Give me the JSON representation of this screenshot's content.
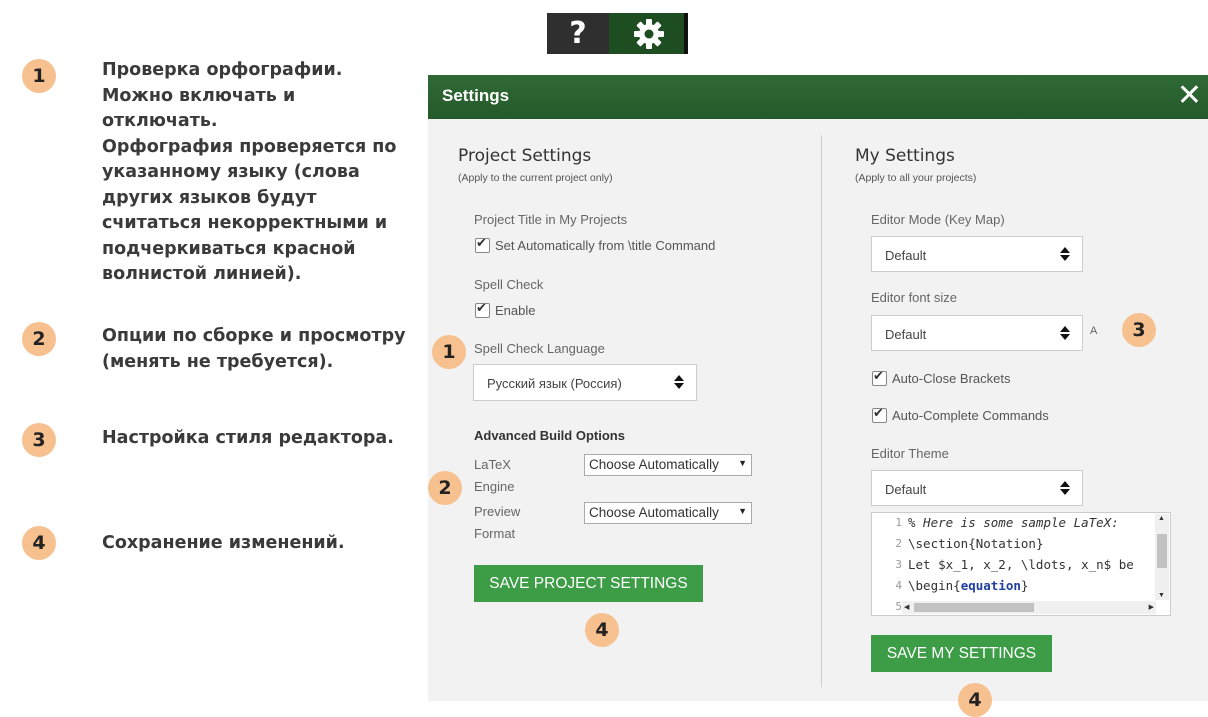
{
  "legend": [
    {
      "num": "1",
      "text": "Проверка орфографии.\nМожно включать и\nотключать.\nОрфография проверяется  по\nуказанному языку (слова\nдругих языков будут\nсчитаться некорректными и\nподчеркиваться красной\nволнистой линией)."
    },
    {
      "num": "2",
      "text": "Опции по сборке и просмотру\n(менять не требуется)."
    },
    {
      "num": "3",
      "text": "Настройка стиля редактора."
    },
    {
      "num": "4",
      "text": "Сохранение изменений."
    }
  ],
  "toolbar": {
    "help_label": "?",
    "gear_icon": "gear-icon"
  },
  "modal": {
    "title": "Settings",
    "close": "✕",
    "project": {
      "heading": "Project Settings",
      "sub": "(Apply to the current project only)",
      "title_label": "Project Title in My Projects",
      "title_check": "Set Automatically from \\title Command",
      "spell_label": "Spell Check",
      "spell_enable": "Enable",
      "lang_label": "Spell Check Language",
      "lang_value": "Русский язык (Россия)",
      "adv_label": "Advanced Build Options",
      "latex_label_1": "LaTeX",
      "latex_label_2": "Engine",
      "latex_value": "Choose Automatically",
      "preview_label_1": "Preview",
      "preview_label_2": "Format",
      "preview_value": "Choose Automatically",
      "save": "SAVE PROJECT SETTINGS"
    },
    "mine": {
      "heading": "My Settings",
      "sub": "(Apply to all your projects)",
      "mode_label": "Editor Mode (Key Map)",
      "mode_value": "Default",
      "font_label": "Editor font size",
      "font_value": "Default",
      "font_unit": "A",
      "auto_close": "Auto-Close Brackets",
      "auto_complete": "Auto-Complete Commands",
      "theme_label": "Editor Theme",
      "theme_value": "Default",
      "save": "SAVE MY SETTINGS"
    },
    "code": {
      "lines": [
        {
          "n": "1"
        },
        {
          "n": "2"
        },
        {
          "n": "3"
        },
        {
          "n": "4"
        },
        {
          "n": "5"
        }
      ],
      "l1": "% Here is some sample LaTeX:",
      "l2_pre": "\\section{",
      "l2_arg": "Notation",
      "l2_post": "}",
      "l3": "Let $x_1, x_2, \\ldots, x_n$ be",
      "l4_pre": "\\begin{",
      "l4_arg": "equation",
      "l4_post": "}"
    }
  },
  "callouts": {
    "c1": "1",
    "c2": "2",
    "c3": "3",
    "c4a": "4",
    "c4b": "4"
  },
  "colors": {
    "header": "#2a6130",
    "button": "#3d9d47",
    "badge": "#f6c08f"
  }
}
